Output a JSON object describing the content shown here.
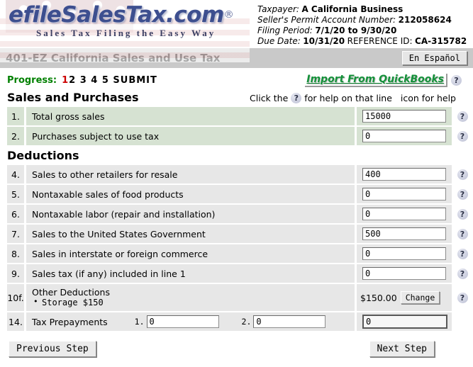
{
  "brand": {
    "logo_text": "efileSalesTax.com",
    "registered_mark": "®",
    "tagline": "Sales Tax Filing the Easy Way"
  },
  "taxpayer": {
    "taxpayer_label": "Taxpayer:",
    "taxpayer_value": "A California Business",
    "permit_label": "Seller's Permit Account Number:",
    "permit_value": "212058624",
    "period_label": "Filing Period:",
    "period_value": "7/1/20 to 9/30/20",
    "due_label": "Due Date:",
    "due_value": "10/31/20",
    "reference_label": "REFERENCE ID:",
    "reference_value": "CA-315782"
  },
  "titlebar": {
    "form_title": "401-EZ California Sales and Use Tax",
    "espanol_button": "En Español"
  },
  "progress": {
    "label": "Progress:",
    "current_step": "1",
    "remaining_steps": "2 3 4 5 SUBMIT",
    "quickbooks_link": "Import From QuickBooks",
    "help_glyph": "?"
  },
  "sections": {
    "sales_and_purchases": "Sales and Purchases",
    "deductions": "Deductions",
    "help_hint_prefix": "Click the",
    "help_hint_suffix": "for help on that line",
    "help_hint_tail": "icon for help"
  },
  "sales_rows": [
    {
      "num": "1.",
      "label": "Total gross sales",
      "value": "15000"
    },
    {
      "num": "2.",
      "label": "Purchases subject to use tax",
      "value": "0"
    }
  ],
  "deduction_rows": [
    {
      "num": "4.",
      "label": "Sales to other retailers for resale",
      "value": "400"
    },
    {
      "num": "5.",
      "label": "Nontaxable sales of food products",
      "value": "0"
    },
    {
      "num": "6.",
      "label": "Nontaxable labor (repair and installation)",
      "value": "0"
    },
    {
      "num": "7.",
      "label": "Sales to the United States Government",
      "value": "500"
    },
    {
      "num": "8.",
      "label": "Sales in interstate or foreign commerce",
      "value": "0"
    },
    {
      "num": "9.",
      "label": "Sales tax (if any) included in line 1",
      "value": "0"
    }
  ],
  "other_deductions_row": {
    "num": "10f.",
    "title": "Other Deductions",
    "item": "Storage  $150",
    "amount": "$150.00",
    "change_button": "Change"
  },
  "prepayments_row": {
    "num": "14.",
    "label": "Tax Prepayments",
    "sub1_num": "1.",
    "sub1_value": "0",
    "sub2_num": "2.",
    "sub2_value": "0",
    "total_value": "0"
  },
  "footer": {
    "previous_button": "Previous Step",
    "next_button": "Next Step"
  },
  "colors": {
    "green_row": "#d6e2d2",
    "gray_row": "#e7e7e7",
    "titlebar": "#c9c9c9",
    "progress_green": "#008000",
    "current_step_red": "#cc0000",
    "quickbooks_green": "#139139",
    "logo_blue": "#3d4f8f"
  }
}
